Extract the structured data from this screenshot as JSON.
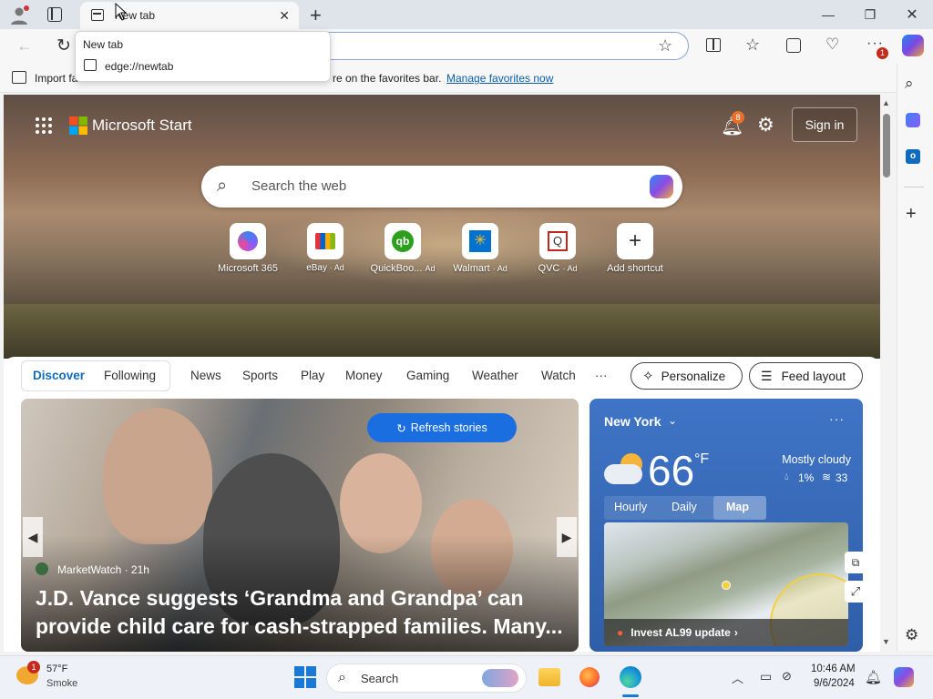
{
  "browser": {
    "tab_title": "New tab",
    "tooltip_title": "New tab",
    "tooltip_url": "edge://newtab",
    "favorites_text": "Import fa",
    "favorites_text_2": "re on the favorites bar.",
    "manage_favorites": "Manage favorites now",
    "extension_badge": "1"
  },
  "msn": {
    "brand": "Microsoft Start",
    "notif_count": "8",
    "sign_in": "Sign in",
    "search_placeholder": "Search the web",
    "shortcuts": [
      {
        "label": "Microsoft 365",
        "ad": ""
      },
      {
        "label": "eBay",
        "ad": "· Ad"
      },
      {
        "label": "QuickBoo...",
        "ad": "Ad"
      },
      {
        "label": "Walmart",
        "ad": "· Ad"
      },
      {
        "label": "QVC",
        "ad": "· Ad"
      },
      {
        "label": "Add shortcut",
        "ad": ""
      }
    ],
    "nav": {
      "discover": "Discover",
      "following": "Following",
      "items": [
        "News",
        "Sports",
        "Play",
        "Money",
        "Gaming",
        "Weather",
        "Watch"
      ],
      "more": "···",
      "personalize": "Personalize",
      "feed_layout": "Feed layout"
    },
    "story": {
      "refresh": "Refresh stories",
      "source": "MarketWatch · 21h",
      "headline_1": "J.D. Vance suggests ‘Grandma and Grandpa’ can",
      "headline_2": "provide child care for cash-strapped families. Many..."
    },
    "weather": {
      "location": "New York",
      "temp": "66",
      "unit": "°F",
      "condition": "Mostly cloudy",
      "precip": "1%",
      "aqi": "33",
      "tabs": [
        "Hourly",
        "Daily",
        "Map"
      ],
      "alert": "Invest AL99 update"
    }
  },
  "taskbar": {
    "temp": "57°F",
    "condition": "Smoke",
    "weather_badge": "1",
    "search": "Search",
    "time": "10:46 AM",
    "date": "9/6/2024"
  }
}
